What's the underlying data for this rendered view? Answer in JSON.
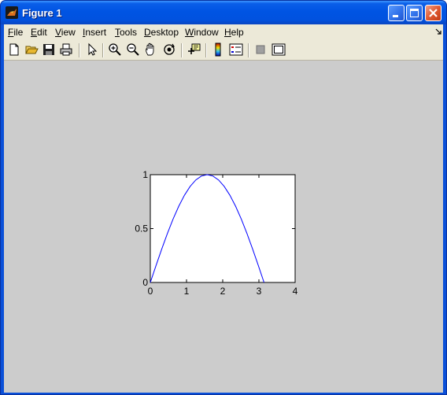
{
  "window": {
    "title": "Figure 1"
  },
  "menu": {
    "items": [
      {
        "label": "File",
        "key": "F",
        "rest": "ile"
      },
      {
        "label": "Edit",
        "key": "E",
        "rest": "dit"
      },
      {
        "label": "View",
        "key": "V",
        "rest": "iew"
      },
      {
        "label": "Insert",
        "key": "I",
        "rest": "nsert"
      },
      {
        "label": "Tools",
        "key": "T",
        "rest": "ools"
      },
      {
        "label": "Desktop",
        "key": "D",
        "rest": "esktop"
      },
      {
        "label": "Window",
        "key": "W",
        "rest": "indow"
      },
      {
        "label": "Help",
        "key": "H",
        "rest": "elp"
      }
    ]
  },
  "toolbar": {
    "icons": [
      "new-figure-icon",
      "open-file-icon",
      "save-figure-icon",
      "print-figure-icon",
      "edit-plot-icon",
      "zoom-in-icon",
      "zoom-out-icon",
      "pan-icon",
      "rotate-3d-icon",
      "data-cursor-icon",
      "insert-colorbar-icon",
      "insert-legend-icon",
      "hide-plot-tools-icon",
      "show-plot-tools-icon"
    ]
  },
  "colors": {
    "line": "#0000ff",
    "figure_bg": "#cccccc",
    "titlebar": "#0054e3"
  },
  "chart_data": {
    "type": "line",
    "title": "",
    "xlabel": "",
    "ylabel": "",
    "xlim": [
      0,
      4
    ],
    "ylim": [
      0,
      1
    ],
    "xticks": [
      "0",
      "1",
      "2",
      "3",
      "4"
    ],
    "yticks": [
      "0",
      "0.5",
      "1"
    ],
    "series": [
      {
        "color": "#0000ff",
        "x": [
          0,
          0.1571,
          0.3142,
          0.4712,
          0.6283,
          0.7854,
          0.9425,
          1.0996,
          1.2566,
          1.4137,
          1.5708,
          1.7279,
          1.885,
          2.042,
          2.1991,
          2.3562,
          2.5133,
          2.6704,
          2.8274,
          2.9845,
          3.1416
        ],
        "y": [
          0,
          0.1564,
          0.309,
          0.454,
          0.5878,
          0.7071,
          0.809,
          0.891,
          0.9511,
          0.9877,
          1,
          0.9877,
          0.9511,
          0.891,
          0.809,
          0.7071,
          0.5878,
          0.454,
          0.309,
          0.1564,
          0
        ]
      }
    ],
    "grid": false
  }
}
